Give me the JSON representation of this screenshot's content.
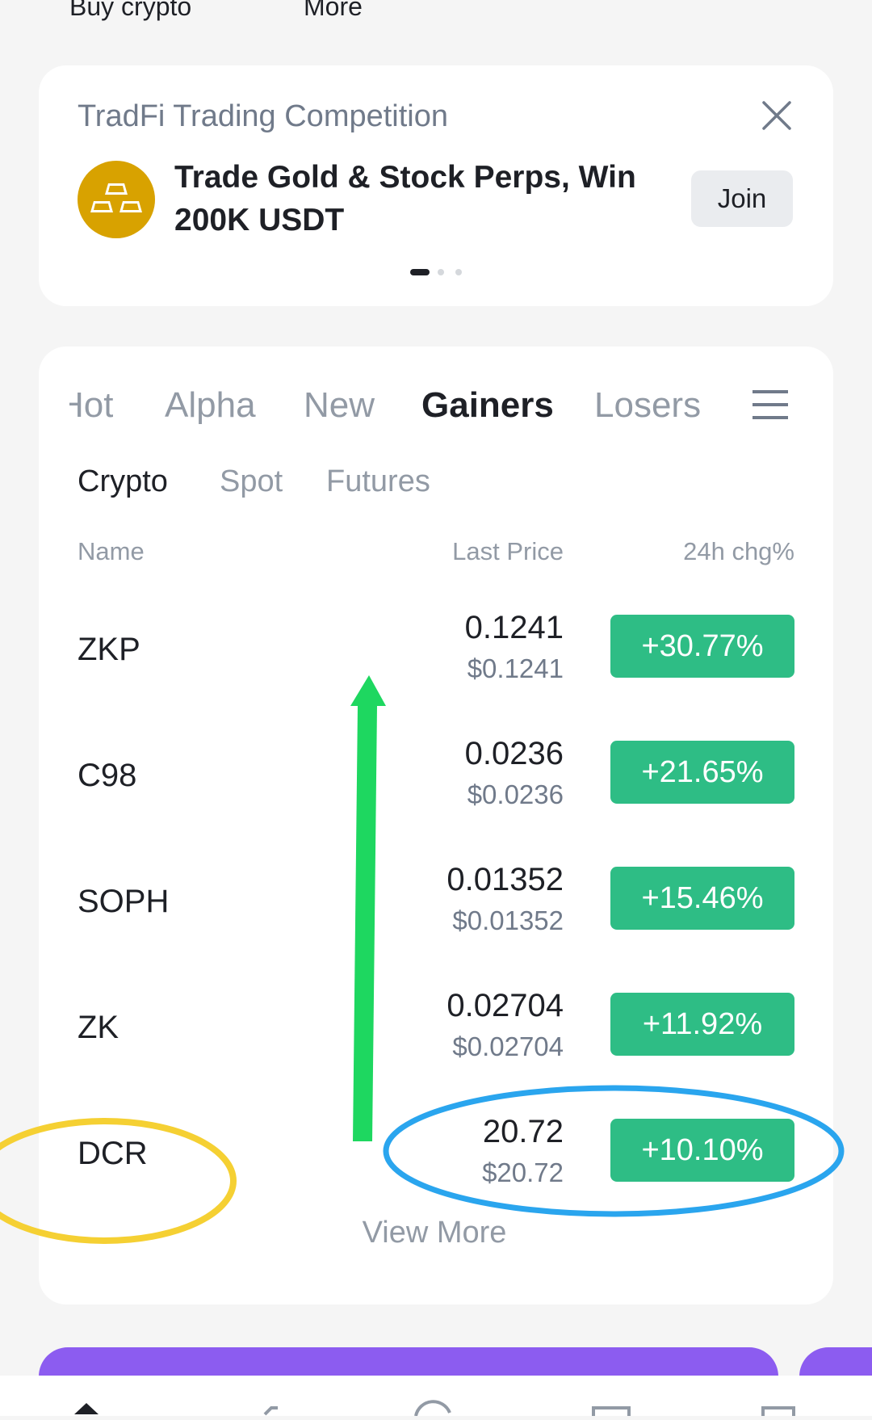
{
  "top_links": {
    "buy_crypto": "Buy crypto",
    "more": "More"
  },
  "promo": {
    "title": "TradFi Trading Competition",
    "text": "Trade Gold & Stock Perps, Win 200K USDT",
    "join_label": "Join",
    "icon": "gold-bars-icon",
    "carousel_total": 3,
    "carousel_active": 1
  },
  "market": {
    "tabs": [
      "Hot",
      "Alpha",
      "New",
      "Gainers",
      "Losers"
    ],
    "active_tab": "Gainers",
    "subtabs": [
      "Crypto",
      "Spot",
      "Futures"
    ],
    "active_subtab": "Crypto",
    "columns": {
      "name": "Name",
      "price": "Last Price",
      "change": "24h chg%"
    },
    "rows": [
      {
        "name": "ZKP",
        "price": "0.1241",
        "usd": "$0.1241",
        "change": "+30.77%"
      },
      {
        "name": "C98",
        "price": "0.0236",
        "usd": "$0.0236",
        "change": "+21.65%"
      },
      {
        "name": "SOPH",
        "price": "0.01352",
        "usd": "$0.01352",
        "change": "+15.46%"
      },
      {
        "name": "ZK",
        "price": "0.02704",
        "usd": "$0.02704",
        "change": "+11.92%"
      },
      {
        "name": "DCR",
        "price": "20.72",
        "usd": "$20.72",
        "change": "+10.10%"
      }
    ],
    "view_more": "View More"
  },
  "colors": {
    "gain": "#2ebd85",
    "banner_purple": "#8c5cf0",
    "annotation_arrow": "#1ed760",
    "annotation_yellow": "#f5d033",
    "annotation_blue": "#2aa5ee",
    "promo_icon_bg": "#d8a200"
  }
}
